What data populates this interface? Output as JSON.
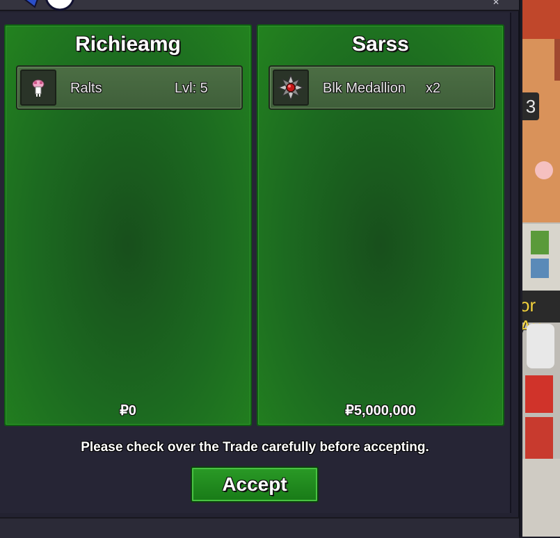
{
  "trade": {
    "left": {
      "player": "Richieamg",
      "item_name": "Ralts",
      "item_extra": "Lvl: 5",
      "money": "₽0"
    },
    "right": {
      "player": "Sarss",
      "item_name": "Blk Medallion",
      "item_extra": "x2",
      "money": "₽5,000,000"
    },
    "notice": "Please check over the Trade carefully before accepting.",
    "accept_label": "Accept"
  },
  "world": {
    "badge": "3",
    "sign_text": "or Au"
  },
  "icons": {
    "left_item": "ralts-sprite-icon",
    "right_item": "blk-medallion-icon"
  },
  "colors": {
    "panel_green": "#1c6a20",
    "button_green": "#2a9a26",
    "window_bg": "#262535"
  }
}
